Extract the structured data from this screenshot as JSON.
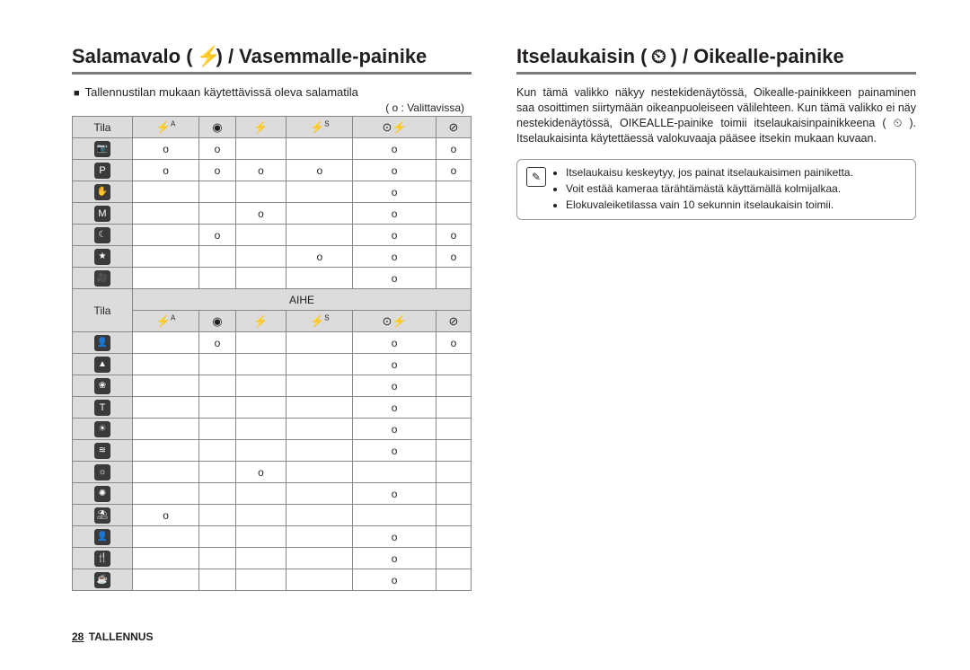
{
  "left": {
    "title_prefix": "Salamavalo (",
    "title_icon": "flash",
    "title_suffix": ") / Vasemmalle-painike",
    "subheading": "Tallennustilan mukaan käytettävissä oleva salamatila",
    "legend": "( o : Valittavissa)",
    "tila_label": "Tila",
    "aihe_label": "AIHE",
    "col_icons": [
      "flash-a",
      "eye",
      "flash",
      "flash-s",
      "flash-slow",
      "flash-off"
    ],
    "rows_top": [
      {
        "icon": "camera",
        "cells": [
          "o",
          "o",
          "",
          "",
          "o",
          "o"
        ]
      },
      {
        "icon": "program",
        "cells": [
          "o",
          "o",
          "o",
          "o",
          "o",
          "o"
        ]
      },
      {
        "icon": "dis",
        "cells": [
          "",
          "",
          "",
          "",
          "o",
          ""
        ]
      },
      {
        "icon": "manual",
        "cells": [
          "",
          "",
          "o",
          "",
          "o",
          ""
        ]
      },
      {
        "icon": "night",
        "cells": [
          "",
          "o",
          "",
          "",
          "o",
          "o"
        ]
      },
      {
        "icon": "scene",
        "cells": [
          "",
          "",
          "",
          "o",
          "o",
          "o"
        ]
      },
      {
        "icon": "movie",
        "cells": [
          "",
          "",
          "",
          "",
          "o",
          ""
        ]
      }
    ],
    "rows_bottom": [
      {
        "icon": "portrait",
        "cells": [
          "",
          "o",
          "",
          "",
          "o",
          "o"
        ]
      },
      {
        "icon": "landscape",
        "cells": [
          "",
          "",
          "",
          "",
          "o",
          ""
        ]
      },
      {
        "icon": "closeup",
        "cells": [
          "",
          "",
          "",
          "",
          "o",
          ""
        ]
      },
      {
        "icon": "text",
        "cells": [
          "",
          "",
          "",
          "",
          "o",
          ""
        ]
      },
      {
        "icon": "sunset",
        "cells": [
          "",
          "",
          "",
          "",
          "o",
          ""
        ]
      },
      {
        "icon": "dawn",
        "cells": [
          "",
          "",
          "",
          "",
          "o",
          ""
        ]
      },
      {
        "icon": "backlight",
        "cells": [
          "",
          "",
          "o",
          "",
          "",
          ""
        ]
      },
      {
        "icon": "firework",
        "cells": [
          "",
          "",
          "",
          "",
          "o",
          ""
        ]
      },
      {
        "icon": "beach",
        "cells": [
          "o",
          "",
          "",
          "",
          "",
          ""
        ]
      },
      {
        "icon": "selfshot",
        "cells": [
          "",
          "",
          "",
          "",
          "o",
          ""
        ]
      },
      {
        "icon": "food",
        "cells": [
          "",
          "",
          "",
          "",
          "o",
          ""
        ]
      },
      {
        "icon": "cafe",
        "cells": [
          "",
          "",
          "",
          "",
          "o",
          ""
        ]
      }
    ]
  },
  "right": {
    "title_prefix": "Itselaukaisin (",
    "title_icon": "timer",
    "title_suffix": ") / Oikealle-painike",
    "paragraph": "Kun tämä valikko näkyy nestekidenäytössä, Oikealle-painikkeen painaminen saa osoittimen siirtymään oikeanpuoleiseen välilehteen. Kun tämä valikko ei näy nestekidenäytössä, OIKEALLE-painike toimii itselaukaisinpainikkeena ( ⏲ ). Itselaukaisinta käytettäessä valokuvaaja pääsee itsekin mukaan kuvaan.",
    "notes": [
      "Itselaukaisu keskeytyy, jos painat itselaukaisimen painiketta.",
      "Voit estää kameraa tärähtämästä käyttämällä kolmijalkaa.",
      "Elokuvaleiketilassa vain 10 sekunnin itselaukaisin toimii."
    ]
  },
  "footer": {
    "page": "28",
    "section": "TALLENNUS"
  },
  "icon_glyphs": {
    "flash-a": "⚡ᴬ",
    "eye": "◉",
    "flash": "⚡",
    "flash-s": "⚡ˢ",
    "flash-slow": "⚡ₛ",
    "flash-off": "⊘",
    "camera": "📷",
    "program": "P",
    "dis": "✋",
    "manual": "M",
    "night": "☾",
    "scene": "★",
    "movie": "🎥",
    "portrait": "👤",
    "landscape": "▲",
    "closeup": "❀",
    "text": "T",
    "sunset": "☀",
    "dawn": "≋",
    "backlight": "☼",
    "firework": "✺",
    "beach": "⛱",
    "selfshot": "👤",
    "food": "🍴",
    "cafe": "☕",
    "timer": "⏲"
  }
}
